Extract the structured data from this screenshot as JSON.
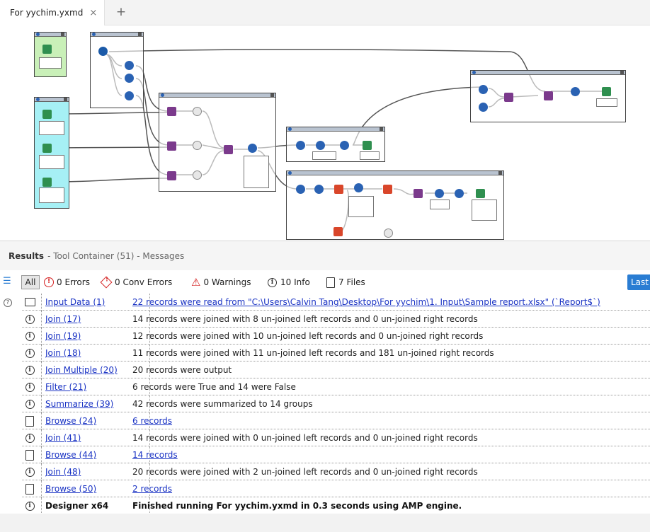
{
  "tab": {
    "title": "For yychim.yxmd",
    "close": "×",
    "new": "+"
  },
  "results": {
    "title": "Results",
    "subtitle": "- Tool Container (51) - Messages"
  },
  "filters": {
    "all": "All",
    "errors": "0 Errors",
    "conv_errors": "0 Conv Errors",
    "warnings": "0 Warnings",
    "info": "10 Info",
    "files": "7 Files",
    "last": "Last"
  },
  "rows": [
    {
      "icon": "folder-icon",
      "source": "Input Data (1)",
      "message": "22 records were read from \"C:\\Users\\Calvin Tang\\Desktop\\For yychim\\1. Input\\Sample report.xlsx\" (`Report$`)",
      "msg_link": true,
      "bold": false
    },
    {
      "icon": "info-icon",
      "source": "Join (17)",
      "message": "14 records were joined with 8 un-joined left records and 0 un-joined right records",
      "msg_link": false,
      "bold": false
    },
    {
      "icon": "info-icon",
      "source": "Join (19)",
      "message": "12 records were joined with 10 un-joined left records and 0 un-joined right records",
      "msg_link": false,
      "bold": false
    },
    {
      "icon": "info-icon",
      "source": "Join (18)",
      "message": "11 records were joined with 11 un-joined left records and 181 un-joined right records",
      "msg_link": false,
      "bold": false
    },
    {
      "icon": "info-icon",
      "source": "Join Multiple (20)",
      "message": "20 records were output",
      "msg_link": false,
      "bold": false
    },
    {
      "icon": "info-icon",
      "source": "Filter (21)",
      "message": "6 records were True and 14 were False",
      "msg_link": false,
      "bold": false
    },
    {
      "icon": "info-icon",
      "source": "Summarize (39)",
      "message": "42 records were summarized to 14 groups",
      "msg_link": false,
      "bold": false
    },
    {
      "icon": "file-icon",
      "source": "Browse (24)",
      "message": "6 records",
      "msg_link": true,
      "bold": false
    },
    {
      "icon": "info-icon",
      "source": "Join (41)",
      "message": "14 records were joined with 0 un-joined left records and 0 un-joined right records",
      "msg_link": false,
      "bold": false
    },
    {
      "icon": "file-icon",
      "source": "Browse (44)",
      "message": "14 records",
      "msg_link": true,
      "bold": false
    },
    {
      "icon": "info-icon",
      "source": "Join (48)",
      "message": "20 records were joined with 2 un-joined left records and 0 un-joined right records",
      "msg_link": false,
      "bold": false
    },
    {
      "icon": "file-icon",
      "source": "Browse (50)",
      "message": "2 records",
      "msg_link": true,
      "bold": false
    },
    {
      "icon": "info-icon",
      "source": "Designer x64",
      "message": "Finished running For yychim.yxmd in 0.3 seconds using AMP engine.",
      "msg_link": false,
      "bold": true
    }
  ]
}
